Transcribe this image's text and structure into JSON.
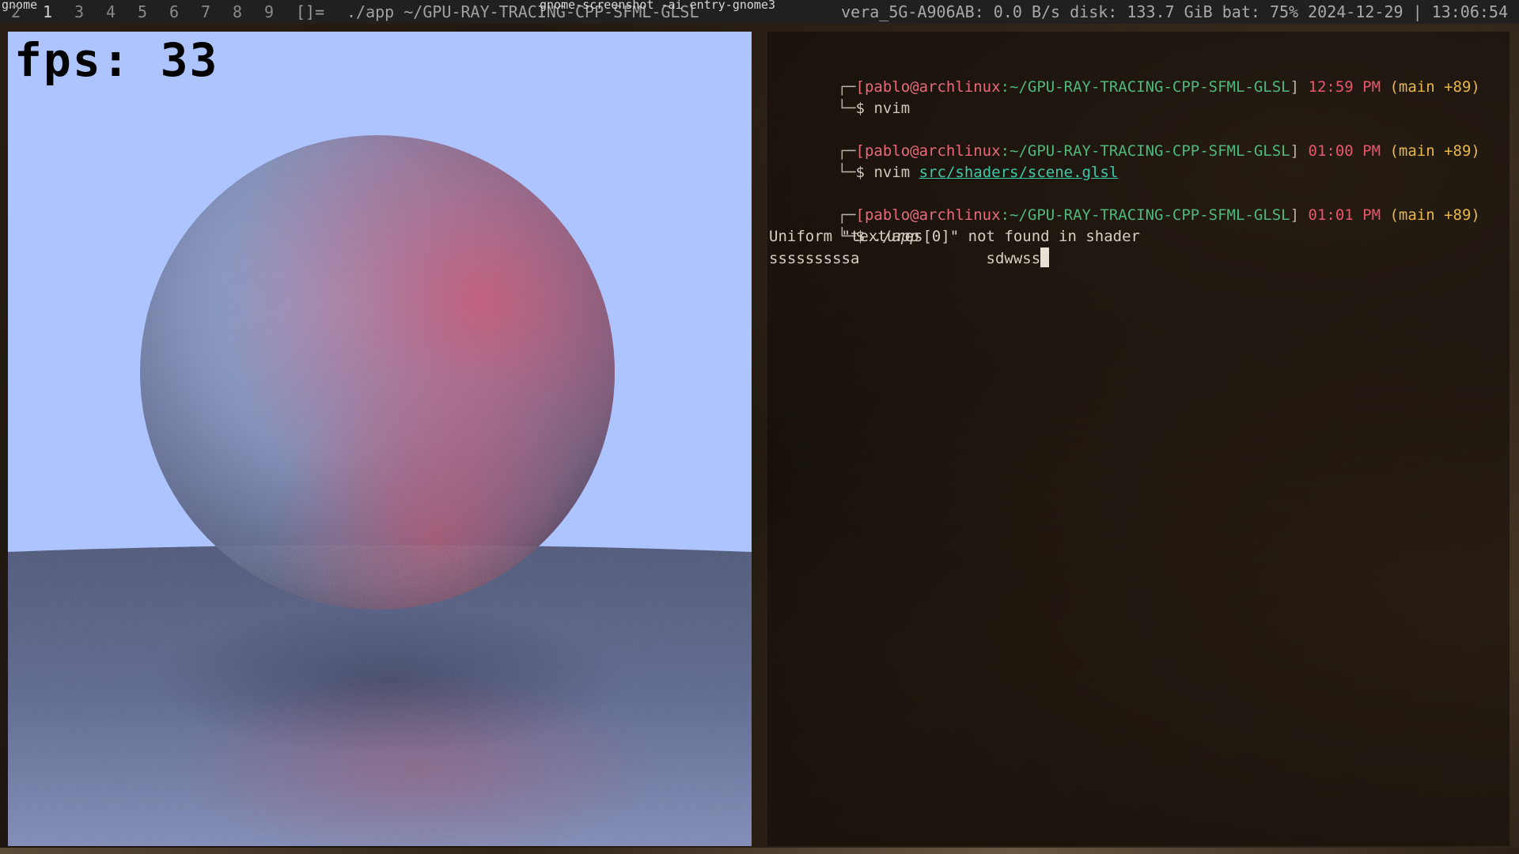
{
  "statusbar": {
    "workspaces": [
      "2",
      "1",
      "3",
      "4",
      "5",
      "6",
      "7",
      "8",
      "9"
    ],
    "active_workspace": "1",
    "layout": "[]=",
    "window_title": "./app ~/GPU-RAY-TRACING-CPP-SFML-GLSL",
    "overlay_title": "gnome-screenshot -ai entry-gnome3",
    "overlay_corner": "gnome",
    "status_text": "vera_5G-A906AB: 0.0 B/s  disk: 133.7 GiB bat: 75%  2024-12-29 | 13:06:54"
  },
  "app_window": {
    "fps_label": "fps: 33",
    "sky_color": "#aec4fe",
    "sphere_color": "#7f8cb0",
    "ground_color": "#5f6a90",
    "noise_tint": "#d04a60"
  },
  "terminal": {
    "prompts": [
      {
        "corner_top": "┌─",
        "corner_bottom": "└─",
        "user": "[pablo@archlinux",
        "path": ":~/GPU-RAY-TRACING-CPP-SFML-GLSL",
        "bracket": "]",
        "time": "12:59 PM",
        "branch": "(main +89)",
        "dollar": "$",
        "command": "nvim",
        "arg": ""
      },
      {
        "corner_top": "┌─",
        "corner_bottom": "└─",
        "user": "[pablo@archlinux",
        "path": ":~/GPU-RAY-TRACING-CPP-SFML-GLSL",
        "bracket": "]",
        "time": "01:00 PM",
        "branch": "(main +89)",
        "dollar": "$",
        "command": "nvim",
        "arg": "src/shaders/scene.glsl"
      },
      {
        "corner_top": "┌─",
        "corner_bottom": "└─",
        "user": "[pablo@archlinux",
        "path": ":~/GPU-RAY-TRACING-CPP-SFML-GLSL",
        "bracket": "]",
        "time": "01:01 PM",
        "branch": "(main +89)",
        "dollar": "$",
        "command": "./app",
        "arg": ""
      }
    ],
    "output": [
      "Uniform \"textures[0]\" not found in shader",
      "sssssssssa              sdwwss"
    ]
  }
}
